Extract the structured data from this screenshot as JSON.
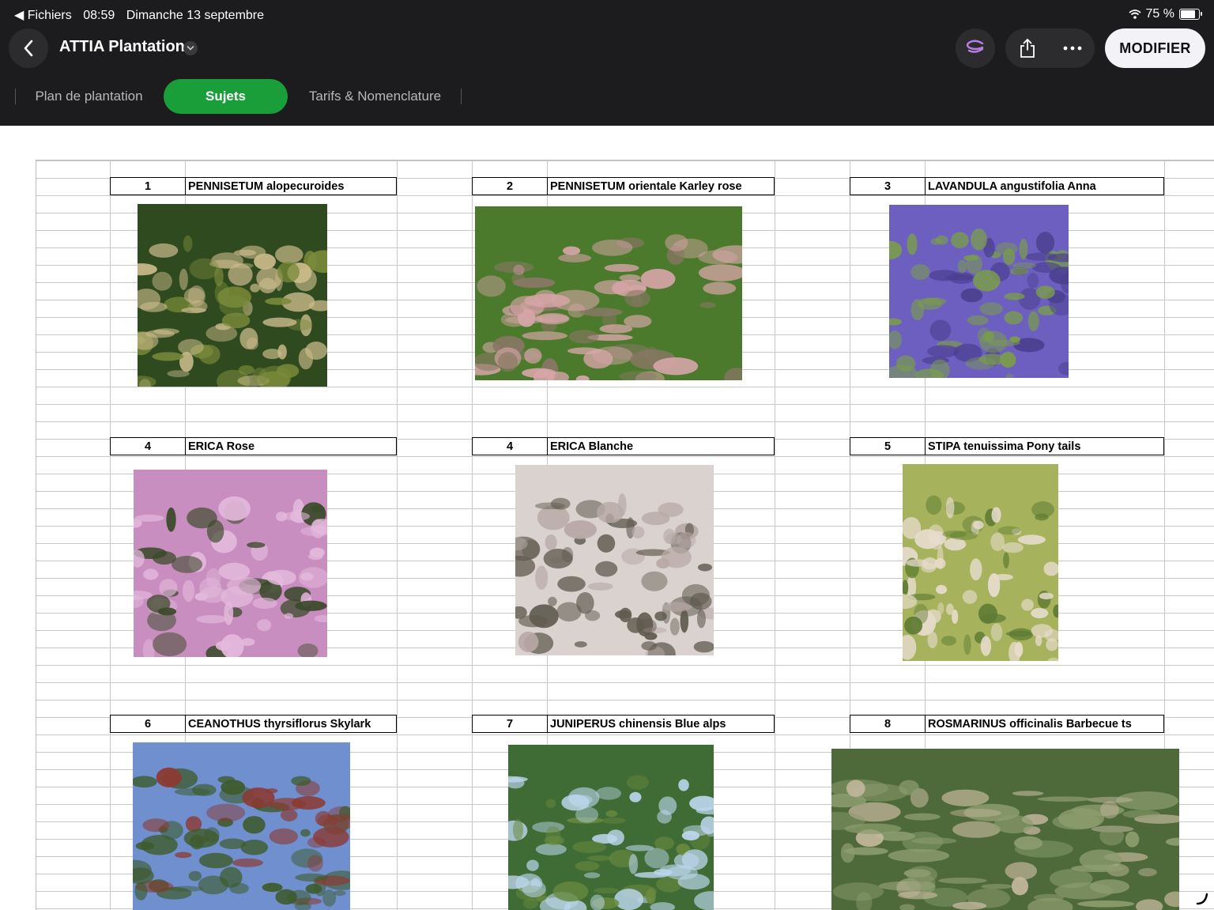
{
  "status_bar": {
    "back_app": "◀ Fichiers",
    "time": "08:59",
    "date": "Dimanche 13 septembre",
    "battery": "75 %"
  },
  "toolbar": {
    "title": "ATTIA Plantation",
    "modify_label": "MODIFIER"
  },
  "tabs": [
    {
      "label": "Plan de plantation",
      "active": false
    },
    {
      "label": "Sujets",
      "active": true
    },
    {
      "label": "Tarifs & Nomenclature",
      "active": false
    }
  ],
  "plants": [
    {
      "num": "1",
      "name": "PENNISETUM alopecuroides",
      "colors": [
        "#2f4a1f",
        "#c9b98a",
        "#7a8a3a"
      ]
    },
    {
      "num": "2",
      "name": "PENNISETUM orientale Karley rose",
      "colors": [
        "#4c7a2c",
        "#d7a5a8",
        "#8a7766"
      ]
    },
    {
      "num": "3",
      "name": "LAVANDULA angustifolia Anna",
      "colors": [
        "#6c5fc0",
        "#7a9c4c",
        "#4b3f8f"
      ]
    },
    {
      "num": "4",
      "name": "ERICA  Rose",
      "colors": [
        "#c98ec0",
        "#e3b9dc",
        "#3b4a2a"
      ]
    },
    {
      "num": "4",
      "name": "ERICA  Blanche",
      "colors": [
        "#d9d2cf",
        "#5f5a4e",
        "#b8a9a6"
      ]
    },
    {
      "num": "5",
      "name": "STIPA tenuissima Pony tails",
      "colors": [
        "#a6b35c",
        "#e7dccd",
        "#5f7c34"
      ]
    },
    {
      "num": "6",
      "name": "CEANOTHUS thyrsiflorus Skylark",
      "colors": [
        "#6f8fcf",
        "#3d5b2b",
        "#8c3a32"
      ]
    },
    {
      "num": "7",
      "name": "JUNIPERUS chinensis Blue alps",
      "colors": [
        "#3f6b35",
        "#bcd6ec",
        "#6a8a3e"
      ]
    },
    {
      "num": "8",
      "name": "ROSMARINUS officinalis Barbecue ts",
      "colors": [
        "#4f6a3a",
        "#8c9c6e",
        "#c6b9a0"
      ]
    }
  ]
}
